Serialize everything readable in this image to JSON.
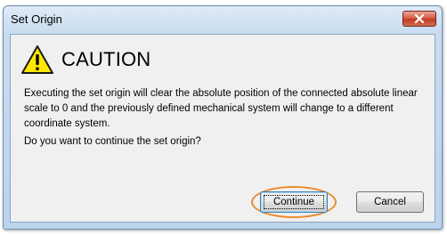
{
  "window": {
    "title": "Set Origin"
  },
  "dialog": {
    "heading": "CAUTION",
    "warning_icon": "warning-triangle-icon",
    "message": "Executing the set origin will clear the absolute position of the connected absolute linear scale to 0 and the previously defined mechanical system will change to a different coordinate system.",
    "question": "Do you want to continue the set origin?"
  },
  "buttons": {
    "continue_label": "Continue",
    "cancel_label": "Cancel"
  },
  "colors": {
    "highlight_ring": "#ec8a2b",
    "warning_fill": "#ffe800",
    "close_button": "#c23b22"
  }
}
